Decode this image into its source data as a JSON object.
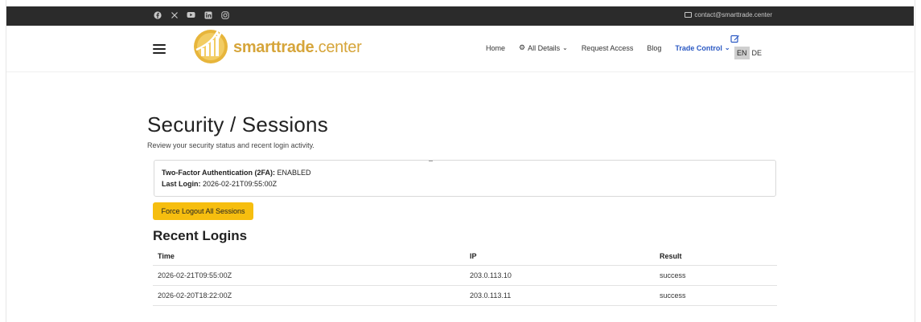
{
  "topbar": {
    "social_icons": [
      "facebook-icon",
      "x-icon",
      "youtube-icon",
      "linkedin-icon",
      "instagram-icon"
    ],
    "contact_email": "contact@smarttrade.center"
  },
  "brand": {
    "name": "smarttrade",
    "suffix": ".center",
    "color": "#d6a53a"
  },
  "nav": {
    "home": "Home",
    "all_details": "All Details",
    "request_access": "Request Access",
    "blog": "Blog",
    "trade_control": "Trade Control",
    "lang_en": "EN",
    "lang_de": "DE"
  },
  "page": {
    "title": "Security / Sessions",
    "subtitle": "Review your security status and recent login activity."
  },
  "status": {
    "twofa_label": "Two-Factor Authentication (2FA):",
    "twofa_value": "ENABLED",
    "last_login_label": "Last Login:",
    "last_login_value": "2026-02-21T09:55:00Z"
  },
  "actions": {
    "force_logout": "Force Logout All Sessions",
    "button_color": "#f6be0f"
  },
  "logins": {
    "title": "Recent Logins",
    "columns": [
      "Time",
      "IP",
      "Result"
    ],
    "rows": [
      {
        "time": "2026-02-21T09:55:00Z",
        "ip": "203.0.113.10",
        "result": "success"
      },
      {
        "time": "2026-02-20T18:22:00Z",
        "ip": "203.0.113.11",
        "result": "success"
      }
    ]
  }
}
